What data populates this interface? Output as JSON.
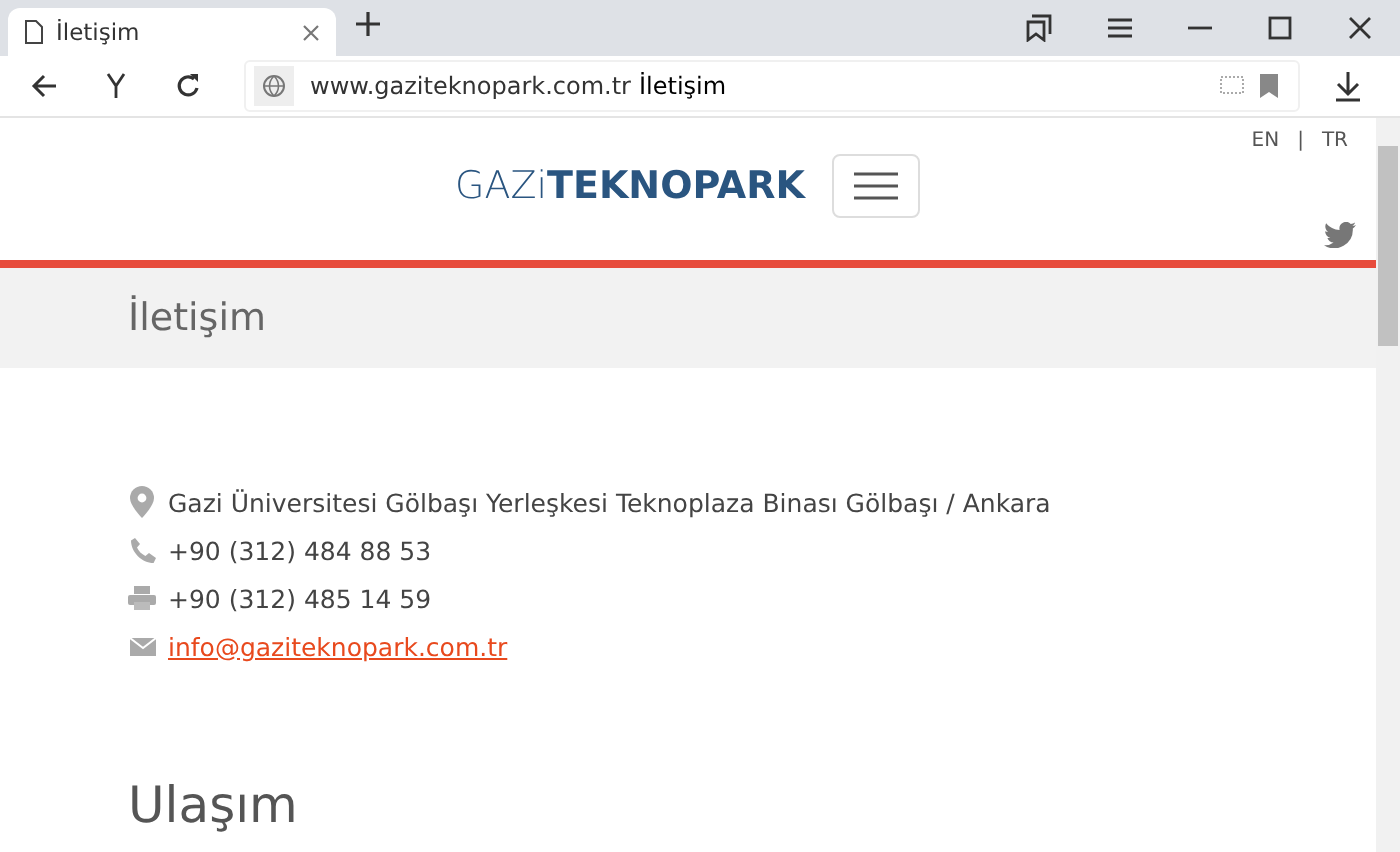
{
  "browser": {
    "tab": {
      "title": "İletişim",
      "selected": true
    },
    "address": {
      "domain": "www.gaziteknopark.com.tr",
      "page_title": "İletişim"
    }
  },
  "header": {
    "logo": "GAZi**TEKNOPARK**",
    "languages": [
      {
        "label": "EN"
      },
      {
        "label": "TR"
      }
    ],
    "separator": "|"
  },
  "page_heading": "İletişim",
  "contact": [
    {
      "kind": "address",
      "text": "Gazi Üniversitesi Gölbaşı Yerleşkesi Teknoplaza Binası Gölbaşı / Ankara"
    },
    {
      "kind": "phone",
      "text": "+90 (312) 484 88 53"
    },
    {
      "kind": "fax",
      "text": "+90 (312) 485 14 59"
    },
    {
      "kind": "email",
      "text": "info@gaziteknopark.com.tr"
    }
  ],
  "section_heading": "Ulaşım"
}
